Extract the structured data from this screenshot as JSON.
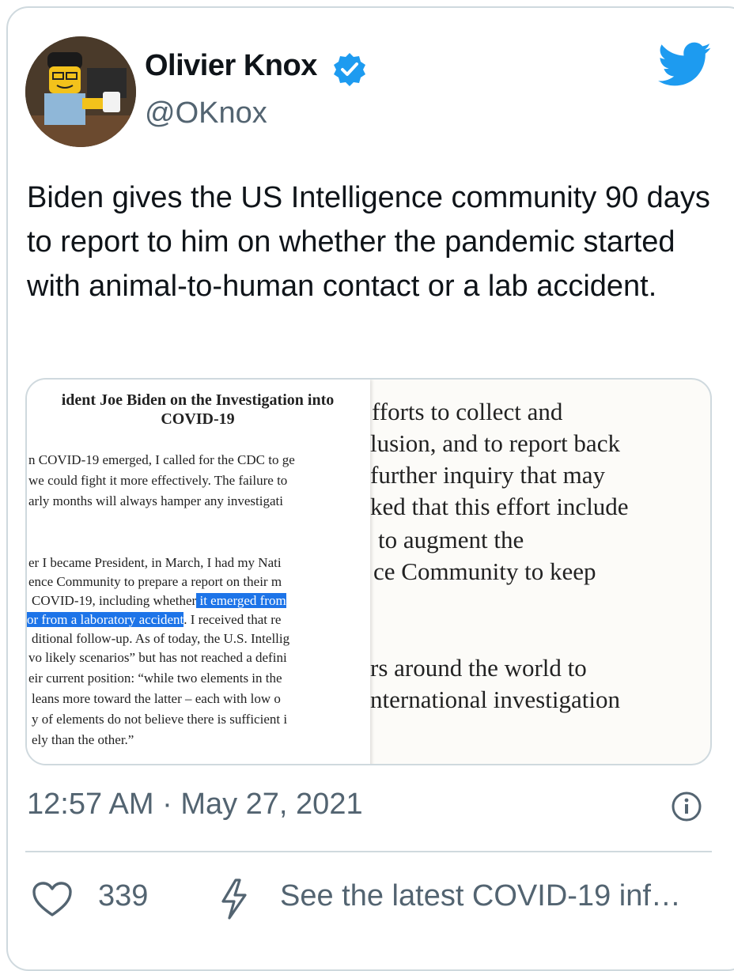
{
  "author": {
    "name": "Olivier Knox",
    "handle": "@OKnox",
    "verified_icon": "verified-badge-icon",
    "avatar": "lego-figure-avatar"
  },
  "brand": {
    "icon": "twitter-bird-icon",
    "color": "#1d9bf0"
  },
  "tweet": {
    "text": "Biden gives the US Intelligence community 90 days to report to him on whether the pandemic started with animal-to-human contact or a lab accident."
  },
  "media": {
    "left_doc": {
      "title_line1": "ident Joe Biden on the Investigation into",
      "title_line2": "COVID-19",
      "para1": [
        "n COVID-19 emerged, I called for the CDC to ge",
        "we could fight it more effectively. The failure to",
        "arly months will always hamper any investigati"
      ],
      "para2": [
        "er I became President, in March, I had my Nati",
        "ence Community to prepare a report on their m",
        "COVID-19, including whether"
      ],
      "highlight1": " it emerged from ",
      "highlight2": "or from a laboratory accident",
      "after_highlight2": ". I received that re",
      "para3": [
        "ditional follow-up. As of today, the U.S. Intellig",
        "vo likely scenarios” but has not reached a defini",
        "eir current position: “while two elements in the",
        "leans more toward the latter – each with low o",
        "y of elements do not believe there is sufficient i",
        "ely than the other.”"
      ]
    },
    "right_doc": [
      "fforts to collect and",
      "lusion, and to report back",
      "further inquiry that may",
      "ked that this effort include",
      "to augment the",
      "ce Community to keep",
      "rs around the world to",
      "nternational investigation"
    ],
    "highlight_color": "#1d74e8"
  },
  "meta": {
    "timestamp": "12:57 AM · May 27, 2021",
    "info_icon": "info-icon"
  },
  "actions": {
    "like_count": "339",
    "covid_link": "See the latest COVID-19 inf…"
  }
}
